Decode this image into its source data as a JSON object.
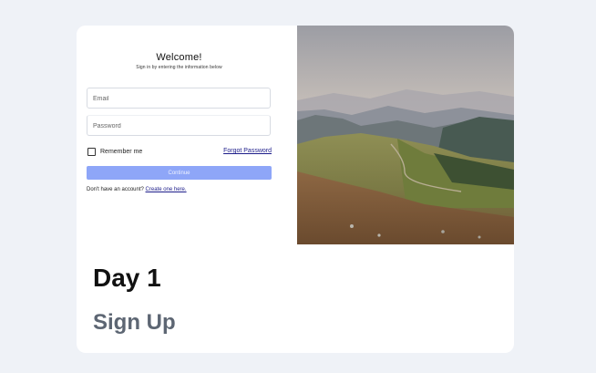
{
  "login": {
    "title": "Welcome!",
    "subtitle": "Sign in by entering the information below",
    "email_placeholder": "Email",
    "password_placeholder": "Password",
    "remember_label": "Remember me",
    "forgot_label": "Forgot Password",
    "continue_label": "Continue",
    "no_account_text": "Don't have an account?",
    "create_link_label": "Create one here."
  },
  "caption": {
    "title": "Day 1",
    "subtitle": "Sign Up"
  },
  "photo": {
    "subject": "mountain-landscape"
  },
  "colors": {
    "page_bg": "#eff2f7",
    "button": "#8ea6f8",
    "link": "#1d1d8a",
    "subtitle_text": "#5d6673"
  }
}
